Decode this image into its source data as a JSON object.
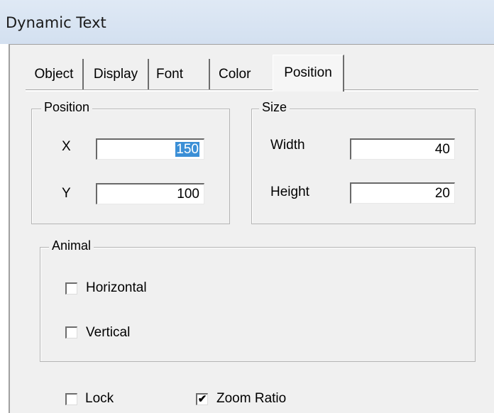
{
  "window": {
    "title": "Dynamic Text"
  },
  "tabs": [
    "Object",
    "Display",
    "Font",
    "Color",
    "Position"
  ],
  "active_tab": "Position",
  "position_group": {
    "legend": "Position",
    "x_label": "X",
    "x_value_selected": "150",
    "x_value_rest": "",
    "y_label": "Y",
    "y_value": "100"
  },
  "size_group": {
    "legend": "Size",
    "width_label": "Width",
    "width_value": "40",
    "height_label": "Height",
    "height_value": "20"
  },
  "animal_group": {
    "legend": "Animal",
    "horizontal_label": "Horizontal",
    "horizontal_checked": false,
    "vertical_label": "Vertical",
    "vertical_checked": false
  },
  "bottom": {
    "lock_label": "Lock",
    "lock_checked": false,
    "zoom_label": "Zoom Ratio",
    "zoom_checked": true,
    "check_mark": "✔"
  }
}
